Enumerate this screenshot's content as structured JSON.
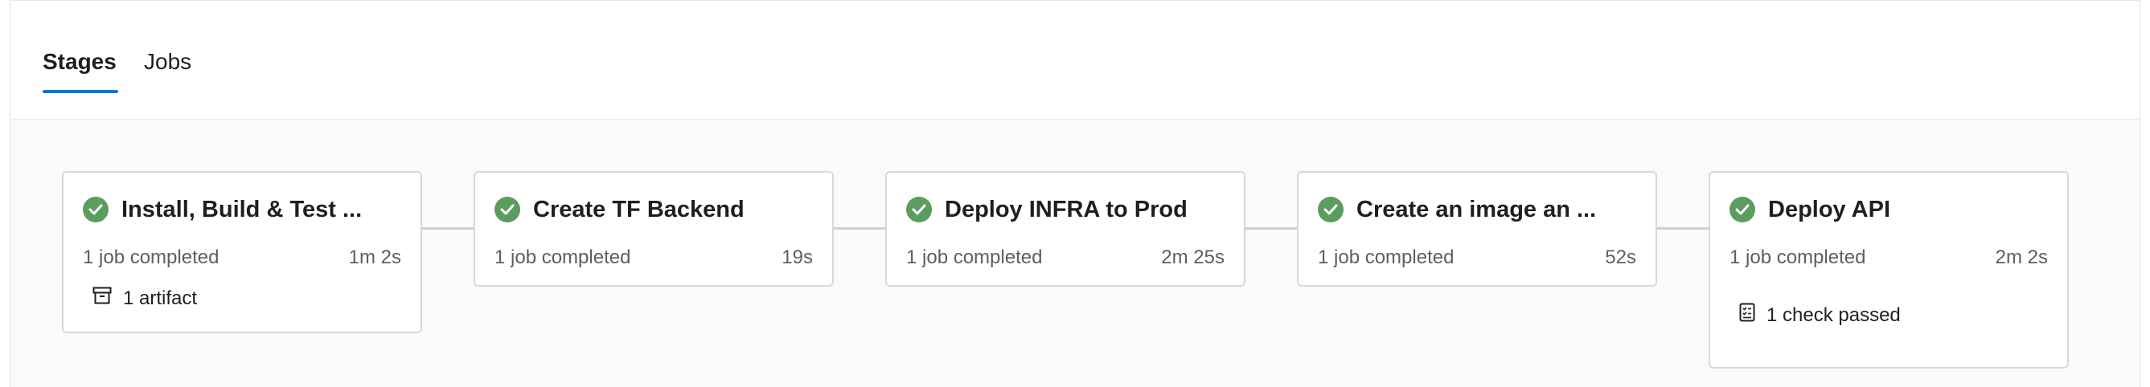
{
  "tabs": [
    {
      "label": "Stages",
      "active": true
    },
    {
      "label": "Jobs",
      "active": false
    }
  ],
  "stages": [
    {
      "title": "Install, Build & Test ...",
      "jobs": "1 job completed",
      "duration": "1m 2s",
      "status": "succeeded",
      "extra": "1 artifact",
      "extra_icon": "artifact-icon"
    },
    {
      "title": "Create TF Backend",
      "jobs": "1 job completed",
      "duration": "19s",
      "status": "succeeded"
    },
    {
      "title": "Deploy INFRA to Prod",
      "jobs": "1 job completed",
      "duration": "2m 25s",
      "status": "succeeded"
    },
    {
      "title": "Create an image an ...",
      "jobs": "1 job completed",
      "duration": "52s",
      "status": "succeeded"
    },
    {
      "title": "Deploy API",
      "jobs": "1 job completed",
      "duration": "2m 2s",
      "status": "succeeded",
      "extra": "1 check passed",
      "extra_icon": "checklist-icon"
    }
  ],
  "colors": {
    "success": "#5b9d5f",
    "accent": "#0078d4"
  }
}
